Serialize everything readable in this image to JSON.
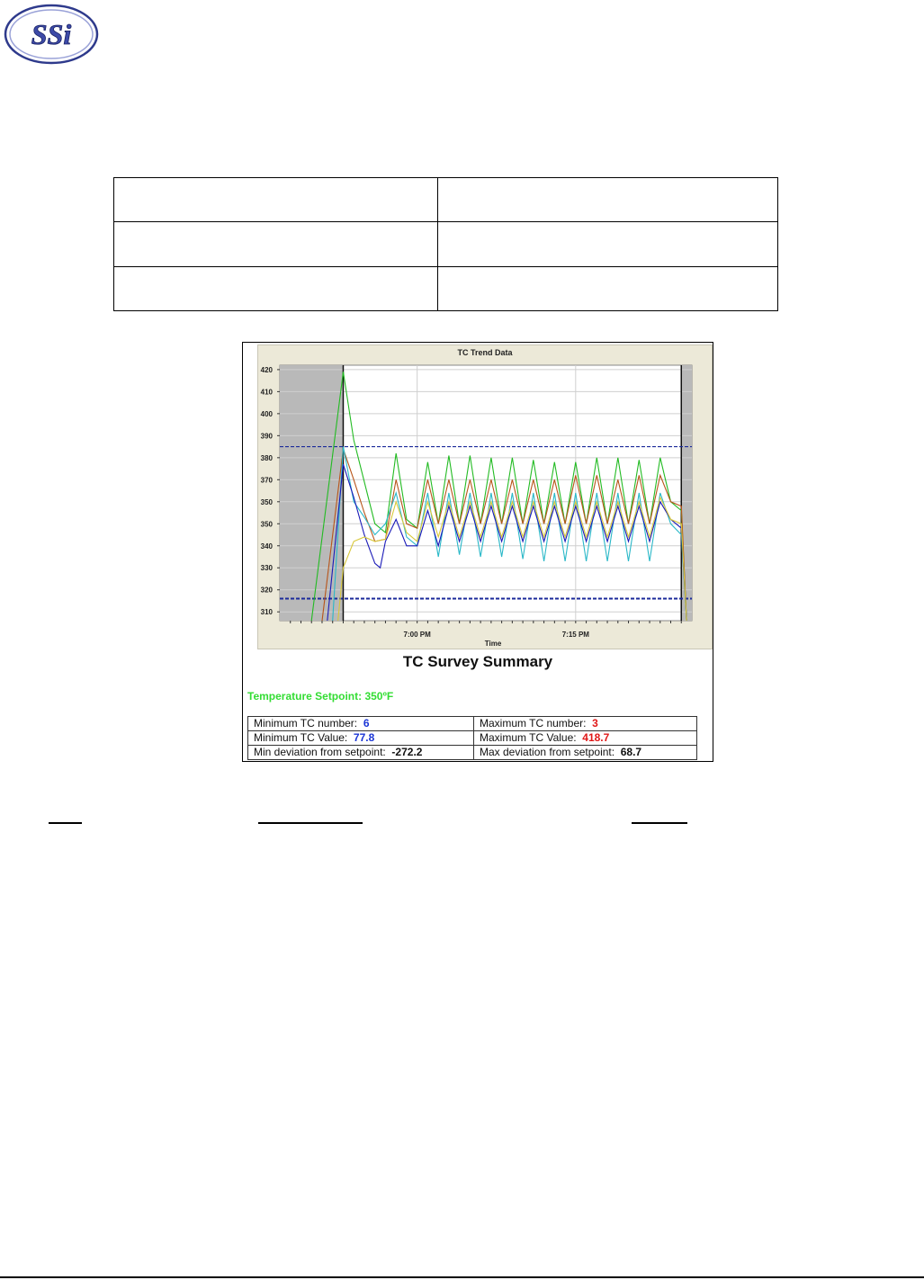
{
  "logo": {
    "text": "SSi"
  },
  "chart_data": {
    "type": "line",
    "title": "TC Trend Data",
    "xlabel": "Time",
    "ylabel": "",
    "ylim": [
      306,
      422
    ],
    "yticks": [
      420,
      410,
      400,
      390,
      380,
      370,
      360,
      350,
      340,
      330,
      320,
      310
    ],
    "ytick_labels": [
      "420",
      "410",
      "400",
      "390",
      "380",
      "370",
      "350",
      "350",
      "340",
      "330",
      "320",
      "310"
    ],
    "x_tick_labels": [
      "7:00 PM",
      "7:15 PM"
    ],
    "x_ticks_minutes": [
      7,
      22
    ],
    "xlim_minutes": [
      -6,
      33
    ],
    "limit_lines": [
      385,
      316
    ],
    "series": [
      {
        "color": "#22bb22",
        "values": [
          [
            -3,
            306
          ],
          [
            0,
            419
          ],
          [
            1,
            388
          ],
          [
            3,
            350
          ],
          [
            4,
            346
          ],
          [
            5,
            382
          ],
          [
            6,
            352
          ],
          [
            7,
            348
          ],
          [
            8,
            378
          ],
          [
            9,
            350
          ],
          [
            10,
            381
          ],
          [
            11,
            350
          ],
          [
            12,
            381
          ],
          [
            13,
            350
          ],
          [
            14,
            380
          ],
          [
            15,
            350
          ],
          [
            16,
            380
          ],
          [
            17,
            350
          ],
          [
            18,
            379
          ],
          [
            19,
            350
          ],
          [
            20,
            378
          ],
          [
            21,
            350
          ],
          [
            22,
            378
          ],
          [
            23,
            350
          ],
          [
            24,
            380
          ],
          [
            25,
            350
          ],
          [
            26,
            380
          ],
          [
            27,
            350
          ],
          [
            28,
            379
          ],
          [
            29,
            350
          ],
          [
            30,
            380
          ],
          [
            31,
            360
          ],
          [
            32,
            356
          ],
          [
            32.5,
            306
          ]
        ]
      },
      {
        "color": "#b8551a",
        "values": [
          [
            -2,
            306
          ],
          [
            0,
            384
          ],
          [
            1,
            370
          ],
          [
            2,
            355
          ],
          [
            3,
            342
          ],
          [
            4,
            343
          ],
          [
            5,
            370
          ],
          [
            6,
            350
          ],
          [
            7,
            348
          ],
          [
            8,
            370
          ],
          [
            9,
            350
          ],
          [
            10,
            370
          ],
          [
            11,
            350
          ],
          [
            12,
            370
          ],
          [
            13,
            350
          ],
          [
            14,
            370
          ],
          [
            15,
            350
          ],
          [
            16,
            370
          ],
          [
            17,
            350
          ],
          [
            18,
            370
          ],
          [
            19,
            350
          ],
          [
            20,
            370
          ],
          [
            21,
            350
          ],
          [
            22,
            372
          ],
          [
            23,
            350
          ],
          [
            24,
            372
          ],
          [
            25,
            350
          ],
          [
            26,
            370
          ],
          [
            27,
            350
          ],
          [
            28,
            372
          ],
          [
            29,
            350
          ],
          [
            30,
            372
          ],
          [
            31,
            360
          ],
          [
            32,
            358
          ],
          [
            32.5,
            306
          ]
        ]
      },
      {
        "color": "#2ab8c8",
        "values": [
          [
            -1,
            306
          ],
          [
            0,
            385
          ],
          [
            1,
            360
          ],
          [
            2,
            353
          ],
          [
            3,
            345
          ],
          [
            4,
            350
          ],
          [
            5,
            364
          ],
          [
            6,
            344
          ],
          [
            7,
            340
          ],
          [
            8,
            364
          ],
          [
            9,
            335
          ],
          [
            10,
            364
          ],
          [
            11,
            336
          ],
          [
            12,
            364
          ],
          [
            13,
            335
          ],
          [
            14,
            364
          ],
          [
            15,
            335
          ],
          [
            16,
            364
          ],
          [
            17,
            334
          ],
          [
            18,
            364
          ],
          [
            19,
            333
          ],
          [
            20,
            364
          ],
          [
            21,
            333
          ],
          [
            22,
            364
          ],
          [
            23,
            333
          ],
          [
            24,
            364
          ],
          [
            25,
            333
          ],
          [
            26,
            364
          ],
          [
            27,
            333
          ],
          [
            28,
            364
          ],
          [
            29,
            333
          ],
          [
            30,
            364
          ],
          [
            31,
            350
          ],
          [
            32,
            345
          ],
          [
            32.5,
            306
          ]
        ]
      },
      {
        "color": "#1a1ab8",
        "values": [
          [
            -1.5,
            306
          ],
          [
            0,
            377
          ],
          [
            1,
            362
          ],
          [
            2,
            345
          ],
          [
            3,
            332
          ],
          [
            3.5,
            330
          ],
          [
            4,
            342
          ],
          [
            5,
            352
          ],
          [
            6,
            340
          ],
          [
            7,
            340
          ],
          [
            8,
            356
          ],
          [
            9,
            340
          ],
          [
            10,
            358
          ],
          [
            11,
            342
          ],
          [
            12,
            358
          ],
          [
            13,
            342
          ],
          [
            14,
            358
          ],
          [
            15,
            342
          ],
          [
            16,
            358
          ],
          [
            17,
            342
          ],
          [
            18,
            358
          ],
          [
            19,
            342
          ],
          [
            20,
            358
          ],
          [
            21,
            342
          ],
          [
            22,
            358
          ],
          [
            23,
            342
          ],
          [
            24,
            358
          ],
          [
            25,
            342
          ],
          [
            26,
            358
          ],
          [
            27,
            342
          ],
          [
            28,
            358
          ],
          [
            29,
            342
          ],
          [
            30,
            360
          ],
          [
            31,
            352
          ],
          [
            32,
            348
          ],
          [
            32.5,
            306
          ]
        ]
      },
      {
        "color": "#d8c83a",
        "values": [
          [
            -0.5,
            306
          ],
          [
            0,
            330
          ],
          [
            1,
            342
          ],
          [
            2,
            344
          ],
          [
            3,
            342
          ],
          [
            4,
            343
          ],
          [
            5,
            360
          ],
          [
            6,
            346
          ],
          [
            7,
            342
          ],
          [
            8,
            360
          ],
          [
            9,
            344
          ],
          [
            10,
            360
          ],
          [
            11,
            344
          ],
          [
            12,
            360
          ],
          [
            13,
            344
          ],
          [
            14,
            360
          ],
          [
            15,
            344
          ],
          [
            16,
            360
          ],
          [
            17,
            344
          ],
          [
            18,
            360
          ],
          [
            19,
            344
          ],
          [
            20,
            360
          ],
          [
            21,
            344
          ],
          [
            22,
            360
          ],
          [
            23,
            344
          ],
          [
            24,
            360
          ],
          [
            25,
            344
          ],
          [
            26,
            360
          ],
          [
            27,
            344
          ],
          [
            28,
            360
          ],
          [
            29,
            344
          ],
          [
            30,
            362
          ],
          [
            31,
            352
          ],
          [
            32,
            350
          ],
          [
            32.5,
            306
          ]
        ]
      }
    ]
  },
  "summary": {
    "title": "TC Survey Summary",
    "setpoint": "Temperature Setpoint: 350ºF",
    "min_tc_number_label": "Minimum TC number:",
    "min_tc_number": "6",
    "max_tc_number_label": "Maximum TC number:",
    "max_tc_number": "3",
    "min_tc_value_label": "Minimum TC Value:",
    "min_tc_value": "77.8",
    "max_tc_value_label": "Maximum TC Value:",
    "max_tc_value": "418.7",
    "min_dev_label": "Min deviation from setpoint:",
    "min_dev": "-272.2",
    "max_dev_label": "Max deviation from setpoint:",
    "max_dev": "68.7"
  }
}
